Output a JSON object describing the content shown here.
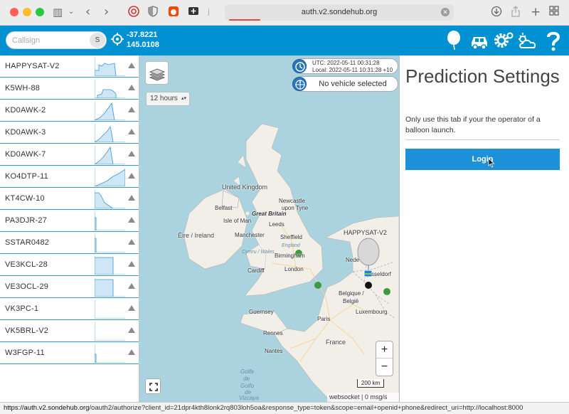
{
  "browser": {
    "url": "auth.v2.sondehub.org"
  },
  "appbar": {
    "callsign_placeholder": "Callsign",
    "search_button": "S",
    "latitude": "-37.8221",
    "longitude": "145.0108"
  },
  "sidebar": {
    "items": [
      {
        "name": "HAPPYSAT-V2"
      },
      {
        "name": "K5WH-88"
      },
      {
        "name": "KD0AWK-2"
      },
      {
        "name": "KD0AWK-3"
      },
      {
        "name": "KD0AWK-7"
      },
      {
        "name": "KO4DTP-11"
      },
      {
        "name": "KT4CW-10"
      },
      {
        "name": "PA3DJR-27"
      },
      {
        "name": "SSTAR0482"
      },
      {
        "name": "VE3KCL-28"
      },
      {
        "name": "VE3OCL-29"
      },
      {
        "name": "VK3PC-1"
      },
      {
        "name": "VK5BRL-V2"
      },
      {
        "name": "W3FGP-11"
      }
    ]
  },
  "map": {
    "hours_selected": "12 hours",
    "utc_time": "UTC: 2022-05-11 00:31:28",
    "local_time": "Local: 2022-05-11 10:31:28 +10",
    "vehicle_status": "No vehicle selected",
    "zoom_in": "+",
    "zoom_out": "−",
    "scale": "200 km",
    "attribution": "websocket | 0 msg/s",
    "labels": {
      "united_kingdom": "United Kingdom",
      "newcastle": "Newcastle",
      "upon_tyne": "upon Tyne",
      "belfast": "Belfast",
      "great_britain": "Great Britain",
      "isle_of_man": "Isle of Man",
      "leeds": "Leeds",
      "eire_ireland": "Éire / Ireland",
      "manchester": "Manchester",
      "sheffield": "Sheffield",
      "england": "England",
      "birmingham": "Birmingham",
      "cymru_wales": "Cymru / Wales",
      "cardiff": "Cardiff",
      "london": "London",
      "happysat": "HAPPYSAT-V2",
      "nederland": "Nede",
      "dusseldorf": "sseldorf",
      "belgique": "Belgique /",
      "belgie": "België",
      "luxembourg": "Luxembourg",
      "guernsey": "Guernsey",
      "paris": "Paris",
      "rennes": "Rennes",
      "france": "France",
      "nantes": "Nantes",
      "golfe": "Golfe",
      "de_gascogne": "de",
      "golfo": "Golfo",
      "de_vizcaya": "de",
      "vizcaya": "Vizcaya"
    }
  },
  "panel": {
    "title": "Prediction Settings",
    "description": "Only use this tab if your the operator of a balloon launch.",
    "login_label": "Login"
  },
  "status_bar": {
    "host": "https://auth.v2.sondehub.org",
    "path": "/oauth2/authorize?client_id=21dpr4kth8lonk2rq803loh5oa&response_type=token&scope=email+openid+phone&redirect_uri=http://localhost:8000"
  },
  "colors": {
    "brand_blue": "#0091d2",
    "login_blue": "#1d92d8",
    "sea": "#aad3df",
    "land": "#f2efe9"
  }
}
